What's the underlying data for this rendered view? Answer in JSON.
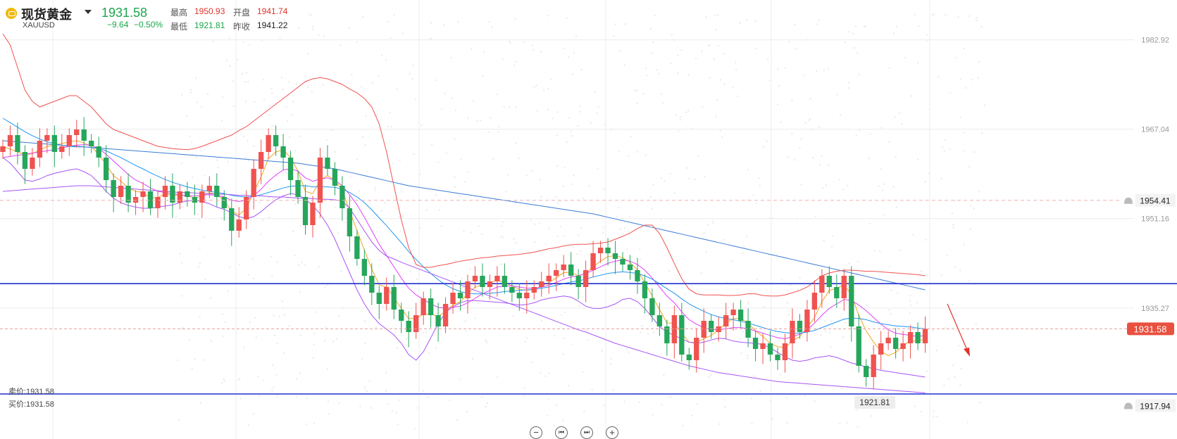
{
  "header": {
    "name": "现货黄金",
    "symbol": "XAUUSD",
    "price": "1931.58",
    "change": "−9.64",
    "change_pct": "−0.50%",
    "high_label": "最高",
    "high": "1950.93",
    "open_label": "开盘",
    "open": "1941.74",
    "low_label": "最低",
    "low": "1921.81",
    "prev_close_label": "昨收",
    "prev_close": "1941.22"
  },
  "quote": {
    "sell": "卖价:1931.58",
    "buy": "买价:1931.58"
  },
  "zoom_controls": [
    "−",
    "⏮",
    "⏭",
    "+"
  ],
  "colors": {
    "up": "#ef5350",
    "down": "#26a65b",
    "ma_fast": "#f5a623",
    "ma_mid": "#e040fb",
    "ma_slow": "#2196f3",
    "ma_long": "#3a7bd5",
    "boll_upper": "#ef5350",
    "boll_lower": "#a855f7",
    "hline": "#1f2fd0"
  },
  "chart_data": {
    "type": "candlestick",
    "y_range": [
      1912,
      1990
    ],
    "y_ticks": [
      "1982.92",
      "1967.04",
      "1951.16",
      "1935.27"
    ],
    "current_price": "1931.58",
    "alert_levels": [
      "1954.41",
      "1917.94"
    ],
    "horizontal_lines": [
      1939.6,
      1920.0
    ],
    "min_label": "1921.81",
    "closes": [
      1964,
      1966,
      1963,
      1960,
      1962,
      1965,
      1966,
      1963,
      1964,
      1966,
      1967,
      1965,
      1964,
      1962,
      1958,
      1955,
      1957,
      1954,
      1955,
      1956,
      1953,
      1955,
      1957,
      1954,
      1956,
      1955,
      1954,
      1956,
      1957,
      1955,
      1953,
      1949,
      1951,
      1955,
      1960,
      1963,
      1966,
      1964,
      1962,
      1958,
      1955,
      1950,
      1954,
      1962,
      1960,
      1957,
      1953,
      1948,
      1944,
      1941,
      1938,
      1936,
      1939,
      1935,
      1933,
      1931,
      1934,
      1937,
      1934,
      1932,
      1936,
      1938,
      1937,
      1940,
      1941,
      1939,
      1940,
      1941,
      1939,
      1938,
      1937,
      1938,
      1939,
      1940,
      1941,
      1942,
      1943,
      1941,
      1939,
      1942,
      1945,
      1946,
      1945,
      1944,
      1943,
      1942,
      1940,
      1937,
      1934,
      1932,
      1929,
      1934,
      1927,
      1926,
      1930,
      1933,
      1931,
      1932,
      1934,
      1935,
      1933,
      1930,
      1928,
      1929,
      1927,
      1926,
      1929,
      1933,
      1931,
      1935,
      1938,
      1941,
      1939,
      1937,
      1941,
      1932,
      1925,
      1923,
      1927,
      1929,
      1930,
      1928,
      1929,
      1931,
      1929,
      1931.58
    ],
    "series": [
      {
        "name": "",
        "values": [
          1964,
          1963.5,
          1963,
          1962.5,
          1962.7,
          1963.3,
          1964,
          1964.2,
          1964.5,
          1964.8,
          1965,
          1964.6,
          1964,
          1962.5,
          1960.8,
          1958.8,
          1957.8,
          1956.6,
          1956,
          1955.8,
          1954.8,
          1954.9,
          1955.6,
          1955.2,
          1955.4,
          1955.2,
          1954.8,
          1955.2,
          1955.8,
          1955.4,
          1954.4,
          1952.5,
          1951.8,
          1953,
          1955.8,
          1958.6,
          1961.8,
          1963,
          1963.4,
          1962,
          1959.6,
          1956,
          1955.6,
          1958,
          1958.8,
          1958,
          1956.2,
          1952.6,
          1949,
          1945.6,
          1942.2,
          1939.4,
          1939,
          1937.2,
          1935.2,
          1933.4,
          1933.4,
          1934.2,
          1934.2,
          1933.8,
          1934.6,
          1935.8,
          1936.4,
          1937.8,
          1939,
          1939.4,
          1939.8,
          1940.2,
          1939.8,
          1939.2,
          1938.6,
          1938.4,
          1938.6,
          1939.2,
          1939.8,
          1940.6,
          1941.6,
          1941.6,
          1941,
          1941.4,
          1942.6,
          1943.6,
          1944.4,
          1944.6,
          1944.2,
          1943.4,
          1942,
          1939.8,
          1937.4,
          1935,
          1932.6,
          1932.6,
          1930.8,
          1929.2,
          1929.2,
          1929.8,
          1930.4,
          1931.4,
          1932.6,
          1933.4,
          1933.4,
          1932.6,
          1931.2,
          1930.2,
          1929,
          1928.4,
          1928.2,
          1929.4,
          1930.2,
          1931.8,
          1933.6,
          1936.4,
          1938.4,
          1938.8,
          1939.4,
          1937.6,
          1934,
          1931.2,
          1929.2,
          1927.6,
          1926.8,
          1927.4,
          1928.6,
          1929.4,
          1929.4,
          1929.8
        ]
      },
      {
        "name": "",
        "values": [
          1962,
          1962.2,
          1962.4,
          1962.6,
          1962.8,
          1963,
          1963.2,
          1963.4,
          1963.7,
          1964,
          1964.2,
          1964.3,
          1964.2,
          1963.6,
          1962.6,
          1961.4,
          1960.2,
          1959,
          1958,
          1957.4,
          1956.6,
          1956,
          1955.8,
          1955.6,
          1955.4,
          1955.2,
          1955.2,
          1955.3,
          1955.4,
          1955.3,
          1955,
          1954.4,
          1954.2,
          1954.4,
          1955.2,
          1956.4,
          1957.8,
          1958.9,
          1959.8,
          1960,
          1959.6,
          1958.4,
          1957.8,
          1958.2,
          1958.4,
          1958,
          1957,
          1955.4,
          1953.6,
          1951.4,
          1949,
          1946.6,
          1944.6,
          1942.6,
          1940.6,
          1938.8,
          1937.6,
          1936.8,
          1936,
          1935.4,
          1935.2,
          1935.4,
          1935.6,
          1936.2,
          1937,
          1937.8,
          1938.4,
          1939,
          1939.2,
          1939.2,
          1939,
          1938.8,
          1938.8,
          1939,
          1939.3,
          1939.8,
          1940.4,
          1940.8,
          1941,
          1941.4,
          1942,
          1942.6,
          1943.2,
          1943.6,
          1943.8,
          1943.6,
          1943,
          1942,
          1940.6,
          1939,
          1937.4,
          1936.2,
          1934.6,
          1933.2,
          1932.4,
          1931.8,
          1931.4,
          1931.4,
          1931.6,
          1931.8,
          1931.8,
          1931.6,
          1931.2,
          1930.8,
          1930.4,
          1930,
          1929.8,
          1930.2,
          1930.6,
          1931.4,
          1932.6,
          1934,
          1935.2,
          1936,
          1936.8,
          1936.6,
          1935.8,
          1934.8,
          1933.6,
          1932.4,
          1931.4,
          1930.8,
          1930.6,
          1930.4,
          1930.2,
          1930.4
        ]
      },
      {
        "name": "",
        "values": [
          1969,
          1968.2,
          1967.4,
          1966.6,
          1965.9,
          1965.3,
          1964.8,
          1964.5,
          1964.2,
          1964,
          1963.9,
          1963.9,
          1963.8,
          1963.6,
          1963.2,
          1962.6,
          1962,
          1961.3,
          1960.6,
          1960,
          1959.3,
          1958.7,
          1958.1,
          1957.6,
          1957.2,
          1956.8,
          1956.5,
          1956.2,
          1956,
          1955.8,
          1955.6,
          1955.3,
          1955.1,
          1955,
          1955.1,
          1955.4,
          1955.8,
          1956.2,
          1956.6,
          1956.9,
          1957,
          1957,
          1956.8,
          1956.8,
          1956.8,
          1956.7,
          1956.4,
          1955.8,
          1955,
          1954,
          1952.7,
          1951.3,
          1949.9,
          1948.4,
          1946.9,
          1945.3,
          1943.9,
          1942.6,
          1941.4,
          1940.3,
          1939.4,
          1938.7,
          1938.2,
          1937.9,
          1937.8,
          1937.8,
          1937.9,
          1938,
          1938.2,
          1938.3,
          1938.4,
          1938.5,
          1938.6,
          1938.8,
          1939,
          1939.3,
          1939.6,
          1939.9,
          1940.1,
          1940.4,
          1940.8,
          1941.1,
          1941.4,
          1941.6,
          1941.7,
          1941.6,
          1941.4,
          1941,
          1940.4,
          1939.6,
          1938.7,
          1937.9,
          1936.9,
          1936,
          1935.3,
          1934.7,
          1934.1,
          1933.7,
          1933.4,
          1933.2,
          1932.9,
          1932.6,
          1932.2,
          1931.8,
          1931.4,
          1931.1,
          1930.9,
          1930.8,
          1930.8,
          1931,
          1931.3,
          1931.8,
          1932.3,
          1932.8,
          1933.3,
          1933.5,
          1933.4,
          1933.2,
          1932.8,
          1932.5,
          1932.3,
          1932.1,
          1932,
          1931.9,
          1931.7,
          1931.6
        ]
      },
      {
        "name": "",
        "values": [
          1965,
          1964.9,
          1964.8,
          1964.7,
          1964.6,
          1964.5,
          1964.4,
          1964.3,
          1964.2,
          1964.1,
          1964,
          1963.9,
          1963.8,
          1963.7,
          1963.6,
          1963.5,
          1963.4,
          1963.3,
          1963.2,
          1963.1,
          1963,
          1962.9,
          1962.8,
          1962.7,
          1962.6,
          1962.5,
          1962.4,
          1962.3,
          1962.2,
          1962.1,
          1962,
          1961.9,
          1961.8,
          1961.7,
          1961.6,
          1961.5,
          1961.4,
          1961.3,
          1961.2,
          1961.1,
          1961,
          1960.8,
          1960.6,
          1960.4,
          1960.2,
          1960,
          1959.7,
          1959.4,
          1959.1,
          1958.8,
          1958.5,
          1958.2,
          1957.9,
          1957.6,
          1957.3,
          1957,
          1956.8,
          1956.6,
          1956.4,
          1956.2,
          1956,
          1955.8,
          1955.6,
          1955.4,
          1955.2,
          1955,
          1954.8,
          1954.6,
          1954.4,
          1954.2,
          1954,
          1953.8,
          1953.6,
          1953.4,
          1953.2,
          1953,
          1952.8,
          1952.6,
          1952.4,
          1952.2,
          1952,
          1951.7,
          1951.4,
          1951.1,
          1950.8,
          1950.5,
          1950.2,
          1949.9,
          1949.6,
          1949.3,
          1949,
          1948.7,
          1948.4,
          1948.1,
          1947.8,
          1947.5,
          1947.2,
          1946.9,
          1946.6,
          1946.3,
          1946,
          1945.7,
          1945.4,
          1945.1,
          1944.8,
          1944.5,
          1944.2,
          1943.9,
          1943.6,
          1943.3,
          1943,
          1942.7,
          1942.4,
          1942.1,
          1941.8,
          1941.5,
          1941.2,
          1940.9,
          1940.6,
          1940.3,
          1940,
          1939.7,
          1939.4,
          1939.1,
          1938.8,
          1938.5
        ]
      },
      {
        "name": "",
        "values": [
          1984,
          1982,
          1978,
          1974,
          1972,
          1971,
          1971.5,
          1972,
          1972.5,
          1973,
          1973,
          1972,
          1971,
          1969.5,
          1968,
          1967,
          1966.5,
          1966,
          1965.5,
          1965,
          1964.5,
          1964,
          1963.8,
          1963.6,
          1963.5,
          1963.4,
          1963.6,
          1964,
          1964.5,
          1965,
          1965.5,
          1966,
          1966.8,
          1967.5,
          1968.5,
          1969.5,
          1970.5,
          1971.5,
          1972.5,
          1973.5,
          1974.5,
          1975.5,
          1976,
          1976.2,
          1976,
          1975.5,
          1975,
          1974.2,
          1973.5,
          1972.5,
          1971,
          1968,
          1963,
          1957,
          1951,
          1946,
          1943,
          1942.5,
          1942.5,
          1942.8,
          1943,
          1943.3,
          1943.6,
          1943.8,
          1944,
          1944.2,
          1944.3,
          1944.5,
          1944.6,
          1944.7,
          1944.8,
          1945,
          1945.2,
          1945.5,
          1945.8,
          1946,
          1946.3,
          1946.5,
          1946.6,
          1946.6,
          1946.7,
          1946.8,
          1947,
          1947.5,
          1948,
          1948.6,
          1949.4,
          1950,
          1950,
          1948.5,
          1946,
          1943.2,
          1940.5,
          1938.6,
          1937.8,
          1937.6,
          1937.6,
          1937.6,
          1937.5,
          1937.5,
          1937.6,
          1937.8,
          1937.8,
          1937.5,
          1937.4,
          1937.4,
          1937.6,
          1938,
          1938.4,
          1939,
          1940,
          1941,
          1941.5,
          1941.8,
          1942,
          1942,
          1941.9,
          1941.8,
          1941.8,
          1941.7,
          1941.6,
          1941.5,
          1941.4,
          1941.3,
          1941.2,
          1941
        ]
      },
      {
        "name": "",
        "values": [
          1962,
          1961,
          1959.5,
          1958,
          1957.8,
          1958.2,
          1958.8,
          1959.2,
          1959.5,
          1959.8,
          1960,
          1959.5,
          1958.8,
          1957.5,
          1956,
          1954.8,
          1954,
          1953.5,
          1953.2,
          1953,
          1953,
          1953.2,
          1953.4,
          1953.6,
          1954,
          1954.3,
          1954.4,
          1954.2,
          1953.8,
          1953.2,
          1952.8,
          1952.2,
          1951.5,
          1951.2,
          1951.5,
          1952.4,
          1953.5,
          1954.5,
          1955.2,
          1955.6,
          1955.4,
          1954.6,
          1953.5,
          1952,
          1950,
          1947.5,
          1944.5,
          1941.5,
          1938.5,
          1936,
          1934,
          1932.5,
          1931.5,
          1930.5,
          1929,
          1927,
          1926,
          1927.5,
          1930,
          1932.5,
          1934.5,
          1935.5,
          1936.2,
          1936.6,
          1936.6,
          1936.5,
          1936.4,
          1936.3,
          1936.2,
          1936,
          1935.8,
          1935.9,
          1936.2,
          1936.7,
          1937,
          1937.2,
          1937.4,
          1937.2,
          1936.5,
          1935.6,
          1935.2,
          1935.2,
          1935.5,
          1936,
          1936.8,
          1937,
          1936.4,
          1935.2,
          1933.6,
          1932,
          1931,
          1930.4,
          1929.8,
          1929.2,
          1929,
          1929.2,
          1929.6,
          1929.9,
          1929.8,
          1929.4,
          1929.2,
          1929.1,
          1929,
          1928.8,
          1928.2,
          1927.4,
          1926.6,
          1926,
          1925.8,
          1926,
          1926.4,
          1926.6,
          1926.8,
          1926.5,
          1926,
          1925.5,
          1925.2,
          1924.8,
          1924.5,
          1924.2,
          1924,
          1923.8,
          1923.6,
          1923.4,
          1923.2,
          1923
        ]
      },
      {
        "name": "",
        "values": [
          1956,
          1956.1,
          1956.2,
          1956.3,
          1956.4,
          1956.5,
          1956.6,
          1956.7,
          1956.8,
          1956.9,
          1957,
          1957,
          1957,
          1956.9,
          1956.8,
          1956.7,
          1956.6,
          1956.5,
          1956.4,
          1956.3,
          1956.2,
          1956.1,
          1956,
          1955.9,
          1955.8,
          1955.8,
          1955.7,
          1955.6,
          1955.6,
          1955.5,
          1955.5,
          1955.4,
          1955.3,
          1955.3,
          1955.2,
          1955.2,
          1955.1,
          1955,
          1955,
          1954.9,
          1954.8,
          1954.8,
          1954.7,
          1954.6,
          1954.6,
          1954.5,
          1954.3,
          1953,
          1951,
          1949,
          1947,
          1945.5,
          1944.5,
          1944,
          1943.4,
          1942.9,
          1942.4,
          1941.9,
          1941.4,
          1940.9,
          1940.4,
          1939.9,
          1939.4,
          1938.9,
          1938.4,
          1937.9,
          1937.4,
          1936.9,
          1936.4,
          1935.9,
          1935.4,
          1934.9,
          1934.4,
          1933.9,
          1933.4,
          1932.9,
          1932.4,
          1931.9,
          1931.4,
          1931,
          1930.5,
          1930,
          1929.5,
          1929,
          1928.6,
          1928.2,
          1927.8,
          1927.4,
          1927,
          1926.6,
          1926.2,
          1925.8,
          1925.4,
          1925,
          1924.7,
          1924.4,
          1924.1,
          1923.8,
          1923.6,
          1923.4,
          1923.2,
          1923,
          1922.8,
          1922.6,
          1922.4,
          1922.2,
          1922.1,
          1922,
          1921.9,
          1921.8,
          1921.7,
          1921.6,
          1921.5,
          1921.4,
          1921.3,
          1921.2,
          1921.1,
          1921,
          1920.9,
          1920.8,
          1920.7,
          1920.6,
          1920.5,
          1920.4,
          1920.3,
          1920.2
        ]
      }
    ]
  }
}
